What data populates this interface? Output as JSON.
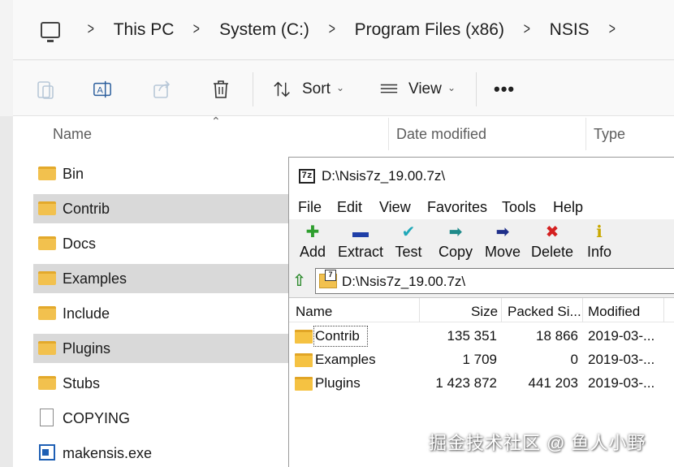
{
  "explorer": {
    "breadcrumb": [
      "This PC",
      "System (C:)",
      "Program Files (x86)",
      "NSIS"
    ],
    "separator": ">",
    "commandbar": {
      "sort_label": "Sort",
      "view_label": "View",
      "more_label": "•••"
    },
    "columns": {
      "name": "Name",
      "date_modified": "Date modified",
      "type": "Type"
    },
    "items": [
      {
        "name": "Bin",
        "kind": "folder",
        "selected": false
      },
      {
        "name": "Contrib",
        "kind": "folder",
        "selected": true
      },
      {
        "name": "Docs",
        "kind": "folder",
        "selected": false
      },
      {
        "name": "Examples",
        "kind": "folder",
        "selected": true
      },
      {
        "name": "Include",
        "kind": "folder",
        "selected": false
      },
      {
        "name": "Plugins",
        "kind": "folder",
        "selected": true
      },
      {
        "name": "Stubs",
        "kind": "folder",
        "selected": false
      },
      {
        "name": "COPYING",
        "kind": "file",
        "selected": false
      },
      {
        "name": "makensis.exe",
        "kind": "exe",
        "selected": false
      }
    ]
  },
  "sevenzip": {
    "title": "D:\\Nsis7z_19.00.7z\\",
    "logo_text": "7z",
    "menu": [
      "File",
      "Edit",
      "View",
      "Favorites",
      "Tools",
      "Help"
    ],
    "toolbar": [
      {
        "label": "Add",
        "icon": "plus-icon",
        "glyph": "✚",
        "color": "#2e9e2e"
      },
      {
        "label": "Extract",
        "icon": "minus-icon",
        "glyph": "▬",
        "color": "#1f3fa8"
      },
      {
        "label": "Test",
        "icon": "check-icon",
        "glyph": "✔",
        "color": "#1fa8b8"
      },
      {
        "label": "Copy",
        "icon": "copy-arrow-icon",
        "glyph": "➡",
        "color": "#1f8a8a"
      },
      {
        "label": "Move",
        "icon": "move-arrow-icon",
        "glyph": "➡",
        "color": "#1f2f8a"
      },
      {
        "label": "Delete",
        "icon": "delete-x-icon",
        "glyph": "✖",
        "color": "#d42020"
      },
      {
        "label": "Info",
        "icon": "info-icon",
        "glyph": "ℹ",
        "color": "#c9a800"
      }
    ],
    "address": "D:\\Nsis7z_19.00.7z\\",
    "columns": {
      "name": "Name",
      "size": "Size",
      "packed": "Packed Si...",
      "modified": "Modified"
    },
    "rows": [
      {
        "name": "Contrib",
        "size": "135 351",
        "packed": "18 866",
        "modified": "2019-03-..."
      },
      {
        "name": "Examples",
        "size": "1 709",
        "packed": "0",
        "modified": "2019-03-..."
      },
      {
        "name": "Plugins",
        "size": "1 423 872",
        "packed": "441 203",
        "modified": "2019-03-..."
      }
    ]
  },
  "watermark": "掘金技术社区 @ 鱼人小野"
}
